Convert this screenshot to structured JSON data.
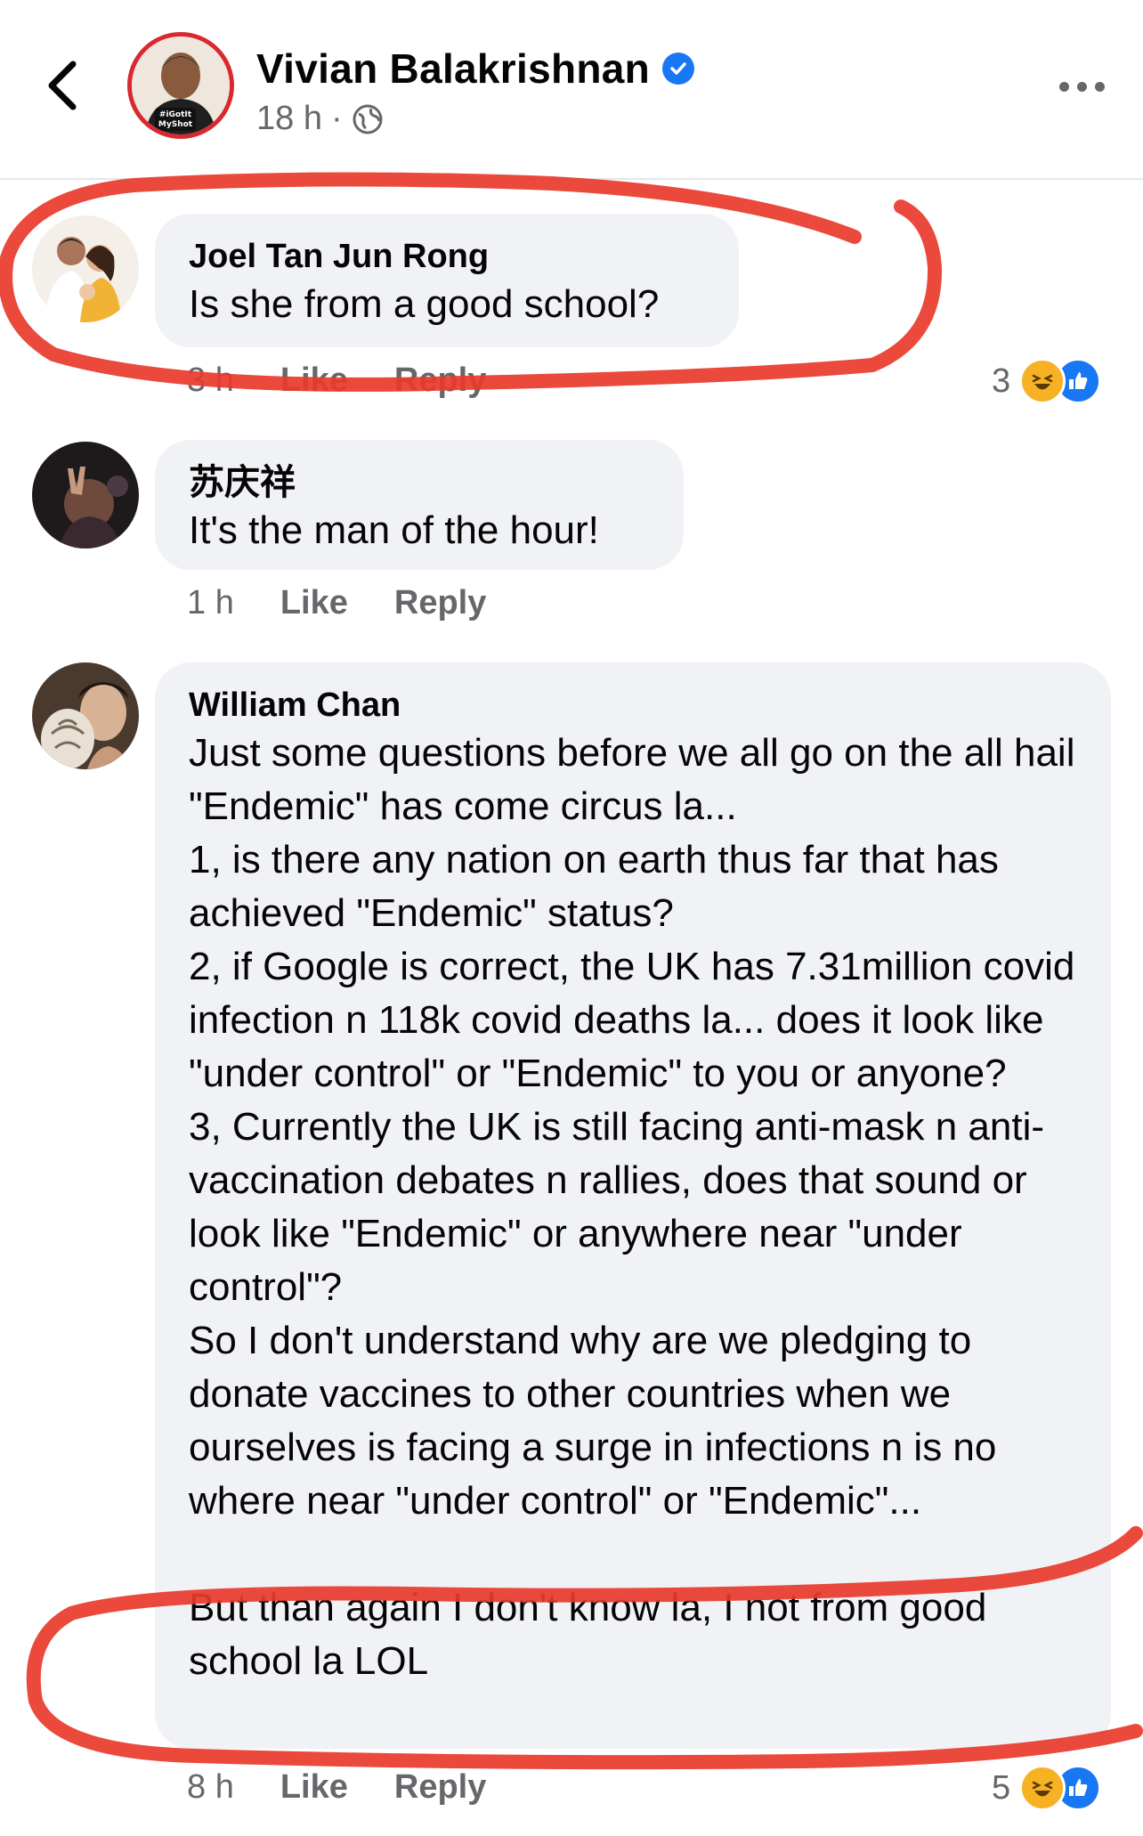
{
  "header": {
    "page_name": "Vivian Balakrishnan",
    "time": "18 h",
    "separator": "·",
    "avatar_badge_line1": "#iGotIt",
    "avatar_badge_line2": "MyShot",
    "icons": {
      "back": "back-arrow-icon",
      "verified": "verified-badge-icon",
      "audience": "globe-icon",
      "more": "more-options-icon"
    },
    "colors": {
      "accent": "#1877f2",
      "avatar_ring": "#d9282f"
    }
  },
  "comments": [
    {
      "author": "Joel Tan Jun Rong",
      "text": "Is she from a good school?",
      "time": "3 h",
      "like_label": "Like",
      "reply_label": "Reply",
      "reaction_count": "3",
      "reaction_icons": [
        "haha-icon",
        "like-icon"
      ]
    },
    {
      "author": "苏庆祥",
      "text": "It's the man of the hour!",
      "time": "1 h",
      "like_label": "Like",
      "reply_label": "Reply"
    },
    {
      "author": "William Chan",
      "text": "Just some questions before we all go on the all hail \"Endemic\" has come circus la...\n1, is there any nation on earth thus far that has achieved \"Endemic\" status?\n2, if Google is correct, the UK has 7.31million covid infection n 118k covid deaths la... does it look like \"under control\" or \"Endemic\" to you or anyone?\n3, Currently the UK is still facing anti-mask n anti-vaccination debates n rallies, does that sound or look like \"Endemic\" or anywhere near \"under control\"?\nSo I don't understand why are we pledging to donate vaccines to other countries when we ourselves is facing a surge in infections n is no where near \"under control\" or \"Endemic\"...\n\nBut than again I don't know la, I not from good school la LOL",
      "time": "8 h",
      "like_label": "Like",
      "reply_label": "Reply",
      "reaction_count": "5",
      "reaction_icons": [
        "haha-icon",
        "like-icon"
      ]
    }
  ],
  "annotation": {
    "color": "#e8392b",
    "type": "hand-drawn-circles"
  }
}
